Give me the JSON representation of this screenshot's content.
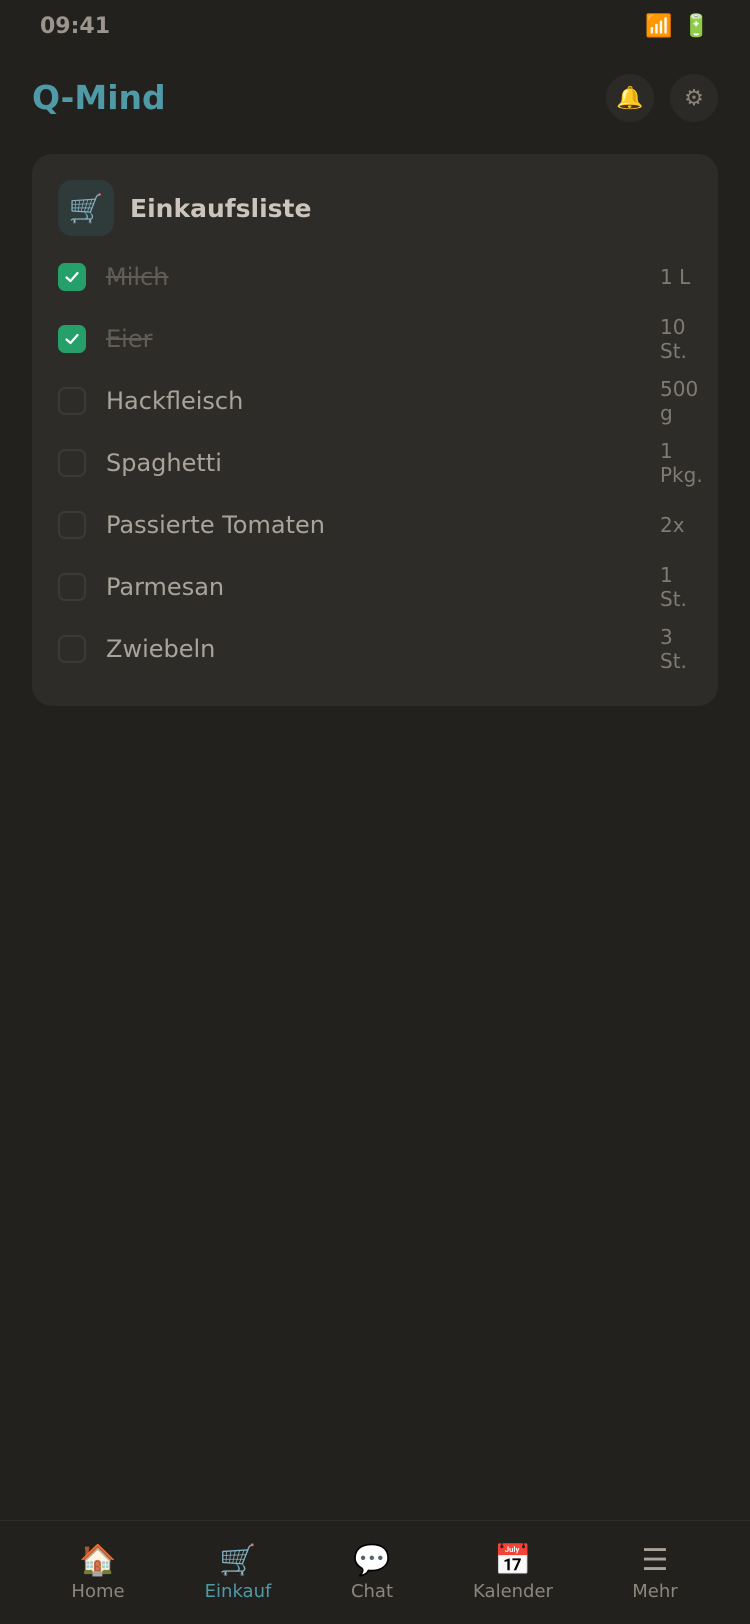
{
  "status": {
    "time": "09:41",
    "signal_icon": "📶",
    "battery_icon": "🔋"
  },
  "header": {
    "title": "Q-Mind",
    "bell_icon": "🔔",
    "settings_icon": "⚙"
  },
  "card": {
    "icon": "🛒",
    "title": "Einkaufsliste",
    "items": [
      {
        "name": "Milch",
        "qty": "1 L",
        "checked": true
      },
      {
        "name": "Eier",
        "qty": "10 St.",
        "checked": true
      },
      {
        "name": "Hackfleisch",
        "qty": "500 g",
        "checked": false
      },
      {
        "name": "Spaghetti",
        "qty": "1 Pkg.",
        "checked": false
      },
      {
        "name": "Passierte Tomaten",
        "qty": "2x",
        "checked": false
      },
      {
        "name": "Parmesan",
        "qty": "1 St.",
        "checked": false
      },
      {
        "name": "Zwiebeln",
        "qty": "3 St.",
        "checked": false
      }
    ]
  },
  "nav": [
    {
      "icon": "🏠",
      "label": "Home",
      "active": false
    },
    {
      "icon": "🛒",
      "label": "Einkauf",
      "active": true
    },
    {
      "icon": "💬",
      "label": "Chat",
      "active": false
    },
    {
      "icon": "📅",
      "label": "Kalender",
      "active": false
    },
    {
      "icon": "☰",
      "label": "Mehr",
      "active": false
    }
  ],
  "colors": {
    "accent": "#4f9aa6",
    "check": "#26a06a",
    "background": "#23211e",
    "card": "#2e2c29"
  }
}
